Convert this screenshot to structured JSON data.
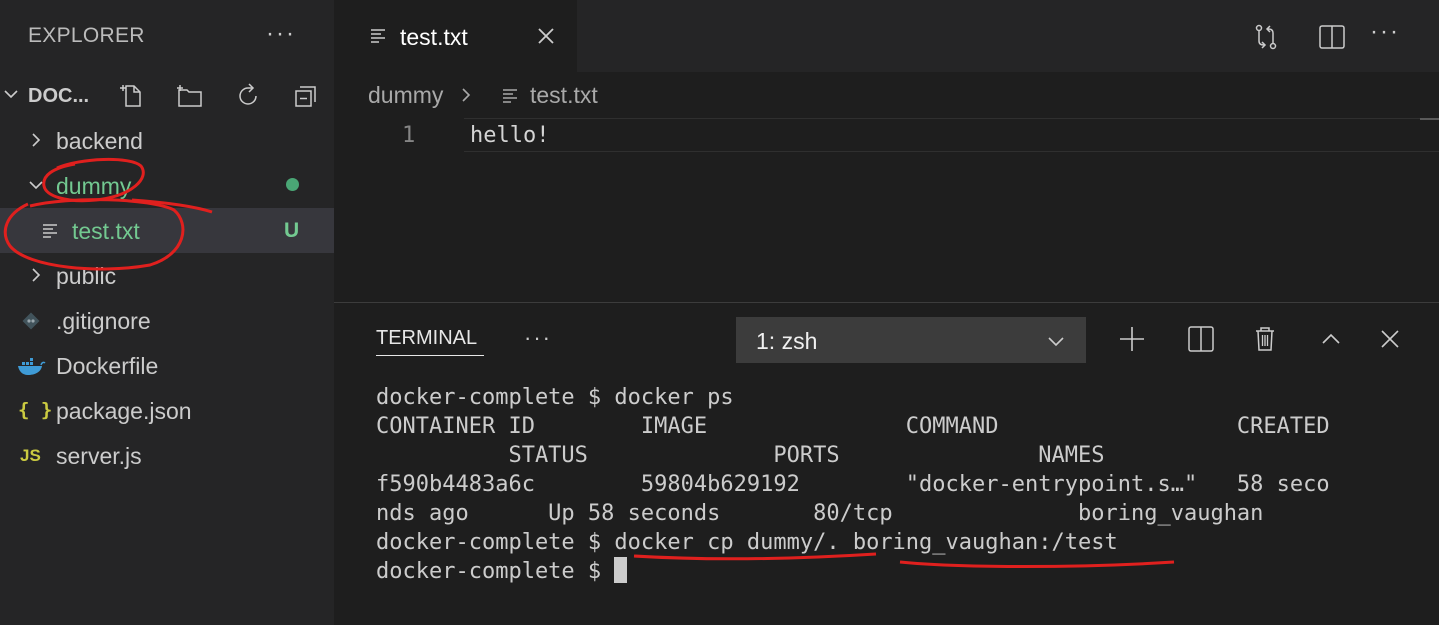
{
  "explorer": {
    "title": "EXPLORER",
    "more": "···",
    "section_label": "DOC...",
    "items": [
      {
        "label": "backend",
        "type": "folder",
        "expanded": false
      },
      {
        "label": "dummy",
        "type": "folder",
        "expanded": true,
        "color": "#73c991"
      },
      {
        "label": "test.txt",
        "type": "file",
        "icon": "text-file-icon",
        "status": "U",
        "color": "#73c991"
      },
      {
        "label": "public",
        "type": "folder",
        "expanded": false
      },
      {
        "label": ".gitignore",
        "type": "file",
        "icon": "git-icon"
      },
      {
        "label": "Dockerfile",
        "type": "file",
        "icon": "docker-icon"
      },
      {
        "label": "package.json",
        "type": "file",
        "icon": "json-icon",
        "icon_text": "{ }"
      },
      {
        "label": "server.js",
        "type": "file",
        "icon": "js-icon",
        "icon_text": "JS"
      }
    ]
  },
  "editor": {
    "tab_label": "test.txt",
    "breadcrumb": {
      "folder": "dummy",
      "file": "test.txt"
    },
    "lines": [
      {
        "number": "1",
        "text": "hello!"
      }
    ]
  },
  "panel": {
    "tab_label": "TERMINAL",
    "more": "···",
    "terminal_select": "1: zsh",
    "terminal_lines": [
      "docker-complete $ docker ps",
      "CONTAINER ID        IMAGE               COMMAND                  CREATED",
      "          STATUS              PORTS               NAMES",
      "f590b4483a6c        59804b629192        \"docker-entrypoint.s…\"   58 seco",
      "nds ago      Up 58 seconds       80/tcp              boring_vaughan",
      "docker-complete $ docker cp dummy/. boring_vaughan:/test",
      "docker-complete $ "
    ]
  },
  "colors": {
    "modified_green": "#73c991",
    "annotation_red": "#e0201e",
    "docker_blue": "#3f9bd6",
    "json_yellow": "#cbcb41",
    "js_yellow": "#cbcb41"
  }
}
